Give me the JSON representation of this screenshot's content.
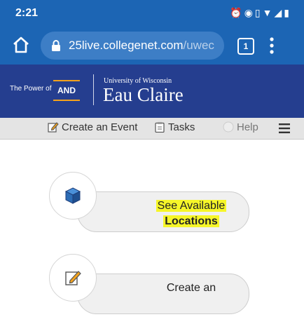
{
  "status_bar": {
    "time": "2:21",
    "icons": [
      "alarm-icon",
      "focus-icon",
      "vibrate-icon",
      "wifi-icon",
      "signal-icon",
      "battery-icon"
    ]
  },
  "browser": {
    "url_host": "25live.collegenet.com",
    "url_path": "/uwec",
    "tab_count": "1"
  },
  "banner": {
    "tagline": "The Power of",
    "tagline_emphasis": "AND",
    "university_line": "University of Wisconsin",
    "university_name": "Eau Claire",
    "colors": {
      "background": "#253e8f",
      "accent": "#f2a21d"
    }
  },
  "nav": {
    "create_event": "Create an Event",
    "tasks": "Tasks",
    "help": "Help"
  },
  "cards": [
    {
      "line1": "See Available",
      "line2": "Locations",
      "icon": "cube-icon",
      "highlighted": true
    },
    {
      "line1": "Create an",
      "icon": "edit-icon"
    }
  ],
  "theme": {
    "chrome_blue": "#1c65b4",
    "highlight": "#f6f629"
  }
}
